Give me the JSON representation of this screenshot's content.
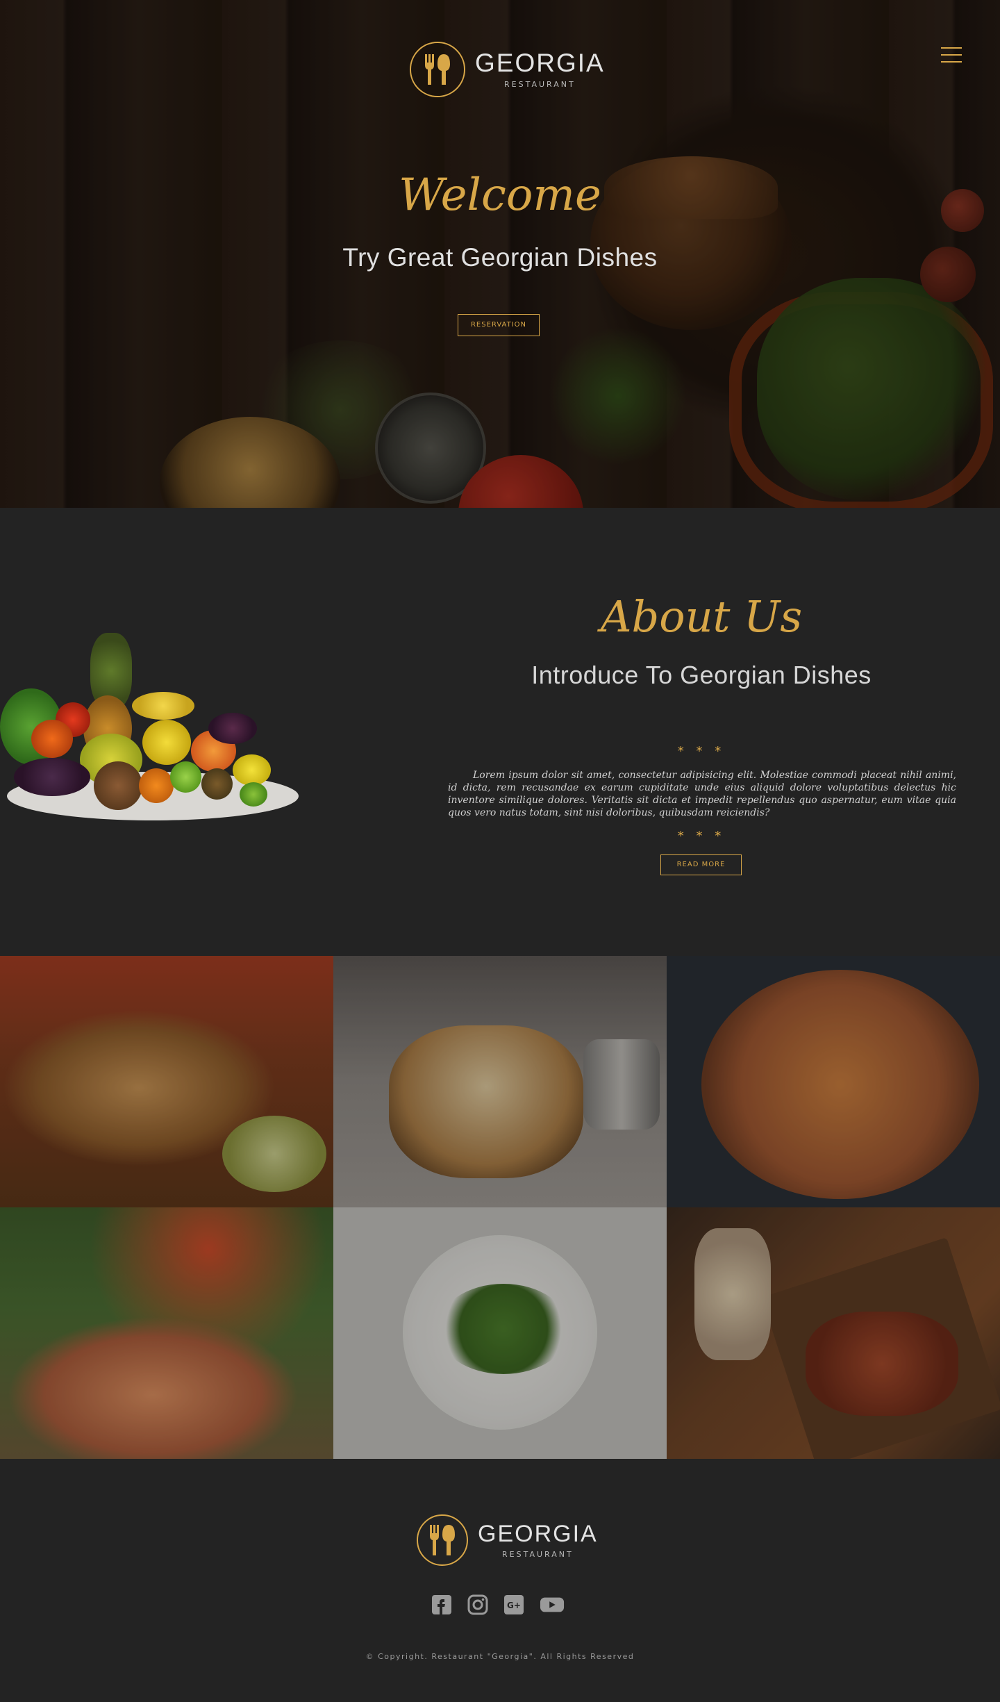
{
  "brand": {
    "name": "GEORGIA",
    "subtitle": "RESTAURANT",
    "accent": "#d8a748",
    "background": "#232323"
  },
  "hero": {
    "welcome": "Welcome",
    "tagline": "Try Great Georgian Dishes",
    "reservation_label": "RESERVATION",
    "menu_icon": "hamburger-menu-icon"
  },
  "about": {
    "title": "About Us",
    "subtitle": "Introduce To Georgian Dishes",
    "stars": "* * *",
    "body": "Lorem ipsum dolor sit amet, consectetur adipisicing elit. Molestiae commodi placeat nihil animi, id dicta, rem recusandae ex earum cupiditate unde eius aliquid dolore voluptatibus delectus hic inventore similique dolores. Veritatis sit dicta et impedit repellendus quo aspernatur, eum vitae quia quos vero natus totam, sint nisi doloribus, quibusdam reiciendis?",
    "read_more_label": "READ MORE"
  },
  "gallery": {
    "tiles": [
      "burrito",
      "pancakes",
      "pizza",
      "salmon-salad",
      "avocado-toast",
      "grilled-salmon-board"
    ]
  },
  "footer": {
    "social": [
      "facebook-icon",
      "instagram-icon",
      "google-plus-icon",
      "youtube-icon"
    ],
    "copyright": "© Copyright. Restaurant \"Georgia\". All Rights Reserved"
  }
}
